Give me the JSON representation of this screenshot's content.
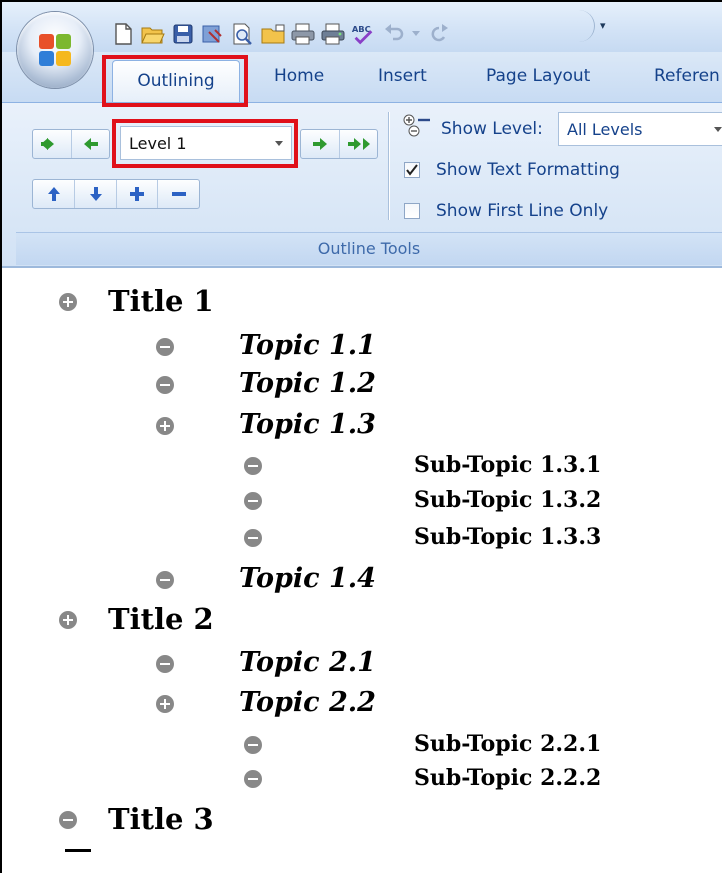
{
  "ribbon": {
    "tabs": [
      "Outlining",
      "Home",
      "Insert",
      "Page Layout",
      "Referen"
    ],
    "group_label": "Outline Tools",
    "level_value": "Level 1",
    "show_level_label": "Show Level:",
    "show_level_value": "All Levels",
    "show_text_formatting_label": "Show Text Formatting",
    "show_text_formatting_checked": true,
    "show_first_line_only_label": "Show First Line Only",
    "show_first_line_only_checked": false,
    "highlight_color": "#e0101a"
  },
  "outline": [
    {
      "text": "Title 1",
      "level": 1,
      "bullet": "plus"
    },
    {
      "text": "Topic 1.1",
      "level": 2,
      "bullet": "minus"
    },
    {
      "text": "Topic 1.2",
      "level": 2,
      "bullet": "minus"
    },
    {
      "text": "Topic 1.3",
      "level": 2,
      "bullet": "plus"
    },
    {
      "text": "Sub-Topic 1.3.1",
      "level": 3,
      "bullet": "minus"
    },
    {
      "text": "Sub-Topic 1.3.2",
      "level": 3,
      "bullet": "minus"
    },
    {
      "text": "Sub-Topic 1.3.3",
      "level": 3,
      "bullet": "minus"
    },
    {
      "text": "Topic 1.4",
      "level": 2,
      "bullet": "minus"
    },
    {
      "text": "Title 2",
      "level": 1,
      "bullet": "plus"
    },
    {
      "text": "Topic 2.1",
      "level": 2,
      "bullet": "minus"
    },
    {
      "text": "Topic 2.2",
      "level": 2,
      "bullet": "plus"
    },
    {
      "text": "Sub-Topic 2.2.1",
      "level": 3,
      "bullet": "minus"
    },
    {
      "text": "Sub-Topic 2.2.2",
      "level": 3,
      "bullet": "minus"
    },
    {
      "text": "Title 3",
      "level": 1,
      "bullet": "minus"
    }
  ]
}
